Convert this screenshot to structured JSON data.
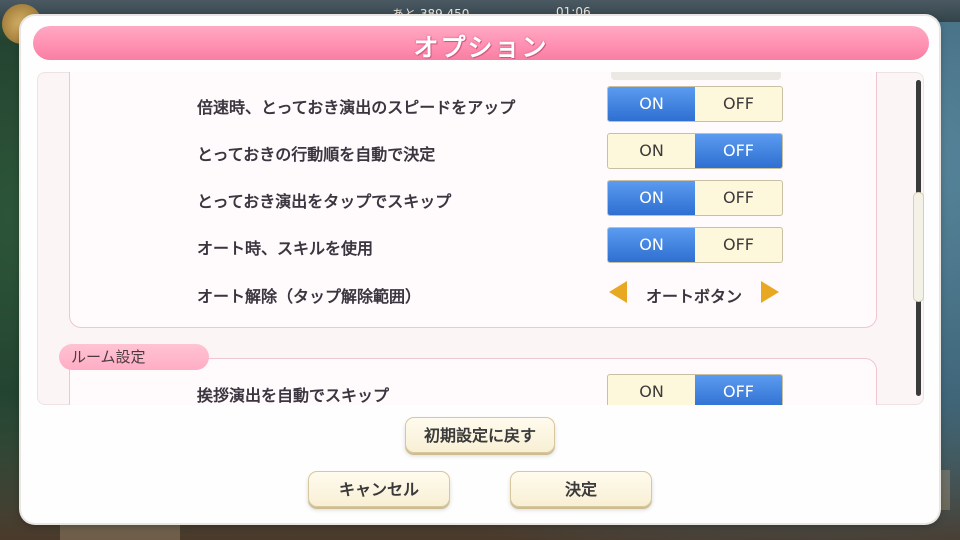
{
  "header": {
    "title": "オプション",
    "currency_text": "あと 389,450",
    "clock": "01:06"
  },
  "options": [
    {
      "label": "倍速時、とっておき演出のスピードをアップ",
      "on": "ON",
      "off": "OFF",
      "selected": "ON"
    },
    {
      "label": "とっておきの行動順を自動で決定",
      "on": "ON",
      "off": "OFF",
      "selected": "OFF"
    },
    {
      "label": "とっておき演出をタップでスキップ",
      "on": "ON",
      "off": "OFF",
      "selected": "ON"
    },
    {
      "label": "オート時、スキルを使用",
      "on": "ON",
      "off": "OFF",
      "selected": "ON"
    }
  ],
  "auto_release": {
    "label": "オート解除（タップ解除範囲）",
    "value": "オートボタン"
  },
  "room_section": {
    "title": "ルーム設定",
    "option": {
      "label": "挨拶演出を自動でスキップ",
      "on": "ON",
      "off": "OFF",
      "selected": "OFF"
    }
  },
  "buttons": {
    "reset": "初期設定に戻す",
    "cancel": "キャンセル",
    "confirm": "決定"
  },
  "colors": {
    "title_bar": "#ff8fb1",
    "toggle_active": "#2e6fd1",
    "arrow": "#e9a821"
  }
}
